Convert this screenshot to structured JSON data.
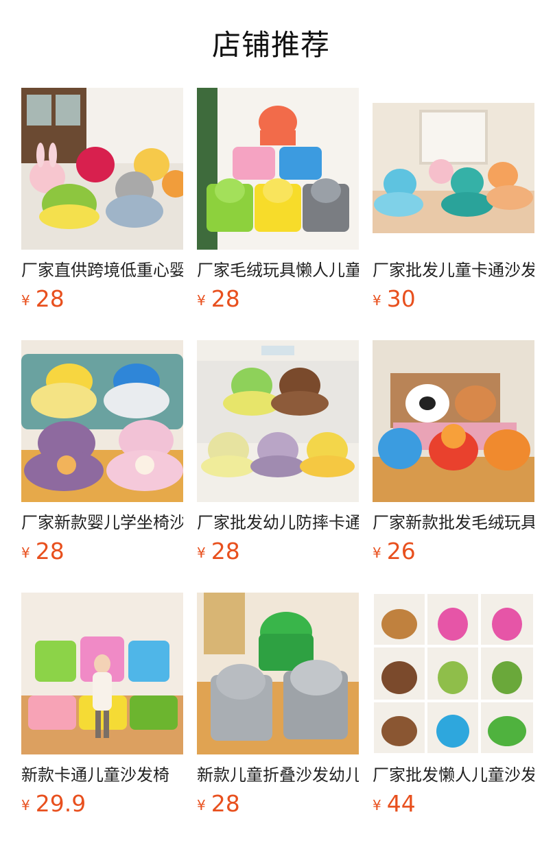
{
  "header": {
    "title": "店铺推荐"
  },
  "currency_symbol": "¥",
  "colors": {
    "price": "#e8501e",
    "title": "#111111",
    "text": "#222222",
    "background": "#ffffff"
  },
  "products": [
    {
      "title": "厂家直供跨境低重心婴儿沙发",
      "price": "28",
      "image": "baby-floor-seat-animals"
    },
    {
      "title": "厂家毛绒玩具懒人儿童沙发",
      "price": "28",
      "image": "kids-fold-sofa-stack"
    },
    {
      "title": "厂家批发儿童卡通沙发",
      "price": "30",
      "image": "baby-seat-living-room"
    },
    {
      "title": "厂家新款婴儿学坐椅沙发",
      "price": "28",
      "image": "crown-baby-seats-on-sofa"
    },
    {
      "title": "厂家批发幼儿防摔卡通沙发",
      "price": "28",
      "image": "animal-baby-seats-stack"
    },
    {
      "title": "厂家新款批发毛绒玩具沙发",
      "price": "26",
      "image": "animal-seats-on-bench"
    },
    {
      "title": "新款卡通儿童沙发椅",
      "price": "29.9",
      "image": "girl-with-fold-sofas"
    },
    {
      "title": "新款儿童折叠沙发幼儿",
      "price": "28",
      "image": "grey-cat-fold-sofas"
    },
    {
      "title": "厂家批发懒人儿童沙发",
      "price": "44",
      "image": "animal-sofa-collage"
    }
  ]
}
